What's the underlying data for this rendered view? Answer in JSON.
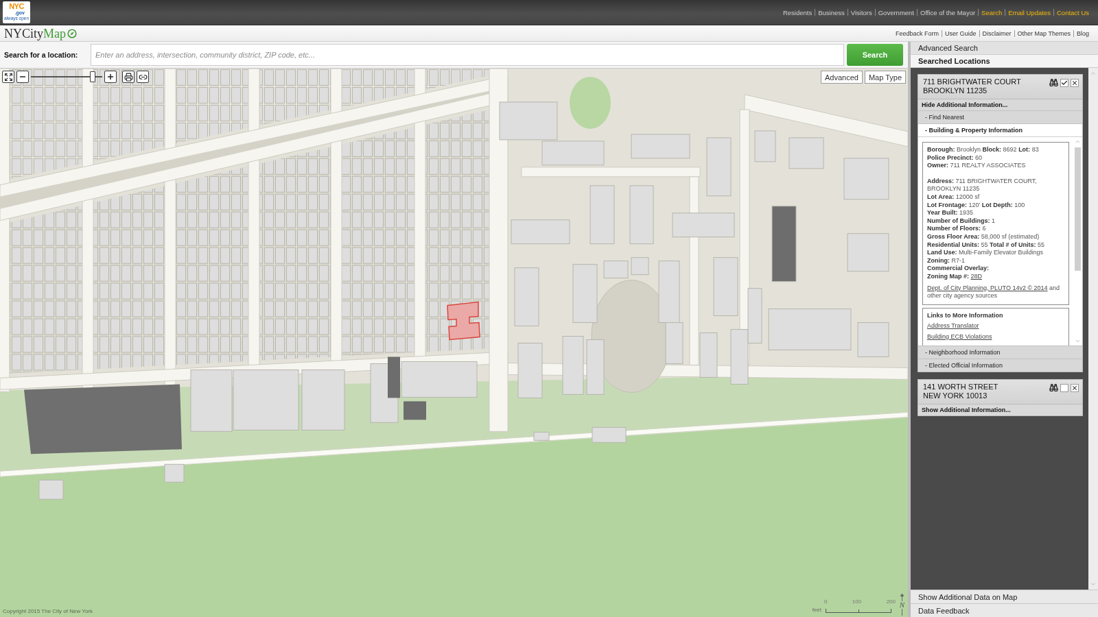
{
  "header": {
    "logo": {
      "mark": "NYC",
      "domain": ".gov",
      "tagline": "always open"
    },
    "links": [
      {
        "label": "Residents",
        "highlighted": false
      },
      {
        "label": "Business",
        "highlighted": false
      },
      {
        "label": "Visitors",
        "highlighted": false
      },
      {
        "label": "Government",
        "highlighted": false
      },
      {
        "label": "Office of the Mayor",
        "highlighted": false
      },
      {
        "label": "Search",
        "highlighted": true
      },
      {
        "label": "Email Updates",
        "highlighted": true
      },
      {
        "label": "Contact Us",
        "highlighted": true
      }
    ]
  },
  "brand_bar": {
    "logo": {
      "primary": "NYCity",
      "accent": "Map"
    },
    "links": [
      "Feedback Form",
      "User Guide",
      "Disclaimer",
      "Other Map Themes",
      "Blog"
    ]
  },
  "search": {
    "label": "Search for a location:",
    "placeholder": "Enter an address, intersection, community district, ZIP code, etc...",
    "button": "Search"
  },
  "map": {
    "zoom": {
      "level": 0.9
    },
    "buttons": [
      "Advanced",
      "Map Type"
    ],
    "copyright": "Copyright 2015 The City of New York",
    "scale": {
      "ticks": [
        "0",
        "100",
        "200"
      ],
      "unit": "feet"
    },
    "north": "N"
  },
  "side_panel": {
    "sections": [
      {
        "label": "Advanced Search",
        "expanded": false
      },
      {
        "label": "Searched Locations",
        "expanded": true
      }
    ],
    "locations": [
      {
        "address_lines": [
          "711 BRIGHTWATER COURT",
          "BROOKLYN 11235"
        ],
        "checked": true,
        "toggle": "Hide Additional Information...",
        "sections": [
          {
            "label": "- Find Nearest",
            "expanded": false
          },
          {
            "label": "- Building & Property Information",
            "expanded": true,
            "details": {
              "groups": [
                [
                  {
                    "parts": [
                      {
                        "kind": "label",
                        "text": "Borough:"
                      },
                      {
                        "kind": "value",
                        "text": "Brooklyn"
                      },
                      {
                        "kind": "label",
                        "text": "Block:"
                      },
                      {
                        "kind": "value",
                        "text": "8692"
                      },
                      {
                        "kind": "label",
                        "text": "Lot:"
                      },
                      {
                        "kind": "value",
                        "text": "83"
                      }
                    ]
                  },
                  {
                    "parts": [
                      {
                        "kind": "label",
                        "text": "Police Precinct:"
                      },
                      {
                        "kind": "value",
                        "text": "60"
                      }
                    ]
                  },
                  {
                    "parts": [
                      {
                        "kind": "label",
                        "text": "Owner:"
                      },
                      {
                        "kind": "value",
                        "text": "711 REALTY ASSOCIATES"
                      }
                    ]
                  }
                ],
                [
                  {
                    "parts": [
                      {
                        "kind": "label",
                        "text": "Address:"
                      },
                      {
                        "kind": "value",
                        "text": "711 BRIGHTWATER COURT, BROOKLYN 11235"
                      }
                    ]
                  },
                  {
                    "parts": [
                      {
                        "kind": "label",
                        "text": "Lot Area:"
                      },
                      {
                        "kind": "value",
                        "text": "12000 sf"
                      }
                    ]
                  },
                  {
                    "parts": [
                      {
                        "kind": "label",
                        "text": "Lot Frontage:"
                      },
                      {
                        "kind": "value",
                        "text": "120'"
                      },
                      {
                        "kind": "label",
                        "text": "Lot Depth:"
                      },
                      {
                        "kind": "value",
                        "text": "100"
                      }
                    ]
                  },
                  {
                    "parts": [
                      {
                        "kind": "label",
                        "text": "Year Built:"
                      },
                      {
                        "kind": "value",
                        "text": "1935"
                      }
                    ]
                  },
                  {
                    "parts": [
                      {
                        "kind": "label",
                        "text": "Number of Buildings:"
                      },
                      {
                        "kind": "value",
                        "text": "1"
                      }
                    ]
                  },
                  {
                    "parts": [
                      {
                        "kind": "label",
                        "text": "Number of Floors:"
                      },
                      {
                        "kind": "value",
                        "text": "6"
                      }
                    ]
                  },
                  {
                    "parts": [
                      {
                        "kind": "label",
                        "text": "Gross Floor Area:"
                      },
                      {
                        "kind": "value",
                        "text": "58,000 sf (estimated)"
                      }
                    ]
                  },
                  {
                    "parts": [
                      {
                        "kind": "label",
                        "text": "Residential Units:"
                      },
                      {
                        "kind": "value",
                        "text": "55"
                      },
                      {
                        "kind": "label",
                        "text": "Total # of Units:"
                      },
                      {
                        "kind": "value",
                        "text": "55"
                      }
                    ]
                  },
                  {
                    "parts": [
                      {
                        "kind": "label",
                        "text": "Land Use:"
                      },
                      {
                        "kind": "value",
                        "text": "Multi-Family Elevator Buildings"
                      }
                    ]
                  },
                  {
                    "parts": [
                      {
                        "kind": "label",
                        "text": "Zoning:"
                      },
                      {
                        "kind": "value",
                        "text": "R7-1"
                      }
                    ]
                  },
                  {
                    "parts": [
                      {
                        "kind": "label",
                        "text": "Commercial Overlay:"
                      }
                    ]
                  },
                  {
                    "parts": [
                      {
                        "kind": "label",
                        "text": "Zoning Map #:"
                      },
                      {
                        "kind": "link",
                        "text": "28D"
                      }
                    ]
                  }
                ]
              ],
              "source": {
                "parts": [
                  {
                    "kind": "link",
                    "text": "Dept. of City Planning, PLUTO 14v2 © 2014"
                  },
                  {
                    "kind": "value",
                    "text": "and other city agency sources"
                  }
                ]
              },
              "links_box": {
                "heading": "Links to More Information",
                "links": [
                  "Address Translator",
                  "Building ECB Violations"
                ]
              }
            }
          },
          {
            "label": "- Neighborhood Information",
            "expanded": false
          },
          {
            "label": "- Elected Official Information",
            "expanded": false
          }
        ]
      },
      {
        "address_lines": [
          "141 WORTH STREET",
          "NEW YORK 10013"
        ],
        "checked": false,
        "toggle": "Show Additional Information..."
      }
    ],
    "footer": [
      "Show Additional Data on Map",
      "Data Feedback"
    ]
  }
}
